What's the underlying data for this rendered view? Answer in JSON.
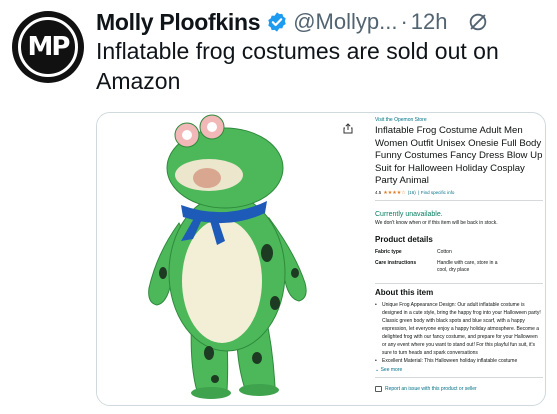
{
  "tweet": {
    "display_name": "Molly Ploofkins",
    "handle": "@Mollyp...",
    "separator": "·",
    "time": "12h",
    "avatar_initials": "MP",
    "avatar_icon": "avatar-mp-logo",
    "verified_icon": "verified-badge-icon",
    "mute_icon": "mute-icon",
    "text": "Inflatable frog costumes are sold out on Amazon",
    "colors": {
      "verified": "#1d9bf0",
      "secondary_text": "#536471"
    }
  },
  "product": {
    "image": "green-inflatable-frog-costume",
    "share_icon": "share-icon",
    "store_link": "Visit the Opemon Store",
    "title": "Inflatable Frog Costume Adult Men Women Outfit Unisex Onesie Full Body Funny Costumes Fancy Dress Blow Up Suit for Halloween Holiday Cosplay Party Animal",
    "rating_value": "4.5",
    "rating_stars": "★★★★☆",
    "rating_count": "(16)",
    "rating_sep": "|",
    "rating_link": "Find specific info",
    "availability": "Currently unavailable.",
    "availability_note": "We don't know when or if this item will be back in stock.",
    "details_heading": "Product details",
    "details": [
      {
        "key": "Fabric type",
        "value": "Cotton"
      },
      {
        "key": "Care instructions",
        "value": "Handle with care, store in a cool, dry place"
      }
    ],
    "about_heading": "About this item",
    "about_bullets": [
      "Unique Frog Appearance Design: Our adult inflatable costume is designed in a cute style, bring the happy frog into your Halloween party! Classic green body with black spots and blue scarf, with a happy expression, let everyone enjoy a happy holiday atmosphere. Become a delighted frog with our fancy costume, and prepare for your Halloween or any event where you want to stand out! For this playful fun suit, it's sure to turn heads and spark conversations",
      "Excellent Material: This Halloween holiday inflatable costume"
    ],
    "see_more": "See more",
    "report": "Report an issue with this product or seller",
    "colors": {
      "link": "#007185",
      "in_stock": "#067d62",
      "stars": "#de7921",
      "frog_green": "#4cb85a",
      "scarf": "#1e5bb8"
    }
  }
}
